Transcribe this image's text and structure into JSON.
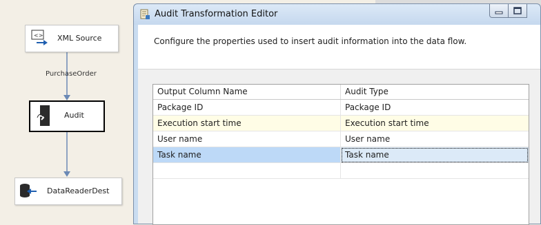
{
  "designer": {
    "xml_source_label": "XML Source",
    "edge_label": "PurchaseOrder",
    "audit_label": "Audit",
    "dest_label": "DataReaderDest"
  },
  "dialog": {
    "title": "Audit Transformation Editor",
    "description": "Configure the properties used to insert audit information into the data flow."
  },
  "grid": {
    "columns": [
      "Output Column Name",
      "Audit Type"
    ],
    "rows": [
      {
        "output_column": "Package ID",
        "audit_type": "Package ID"
      },
      {
        "output_column": "Execution start time",
        "audit_type": "Execution start time"
      },
      {
        "output_column": "User name",
        "audit_type": "User name"
      },
      {
        "output_column": "Task name",
        "audit_type": "Task name"
      },
      {
        "output_column": "",
        "audit_type": ""
      }
    ],
    "selected_row": 3
  },
  "colors": {
    "alt_row": "#fffde6",
    "selected_row": "#bdd9f7",
    "connector": "#6b89b5"
  }
}
